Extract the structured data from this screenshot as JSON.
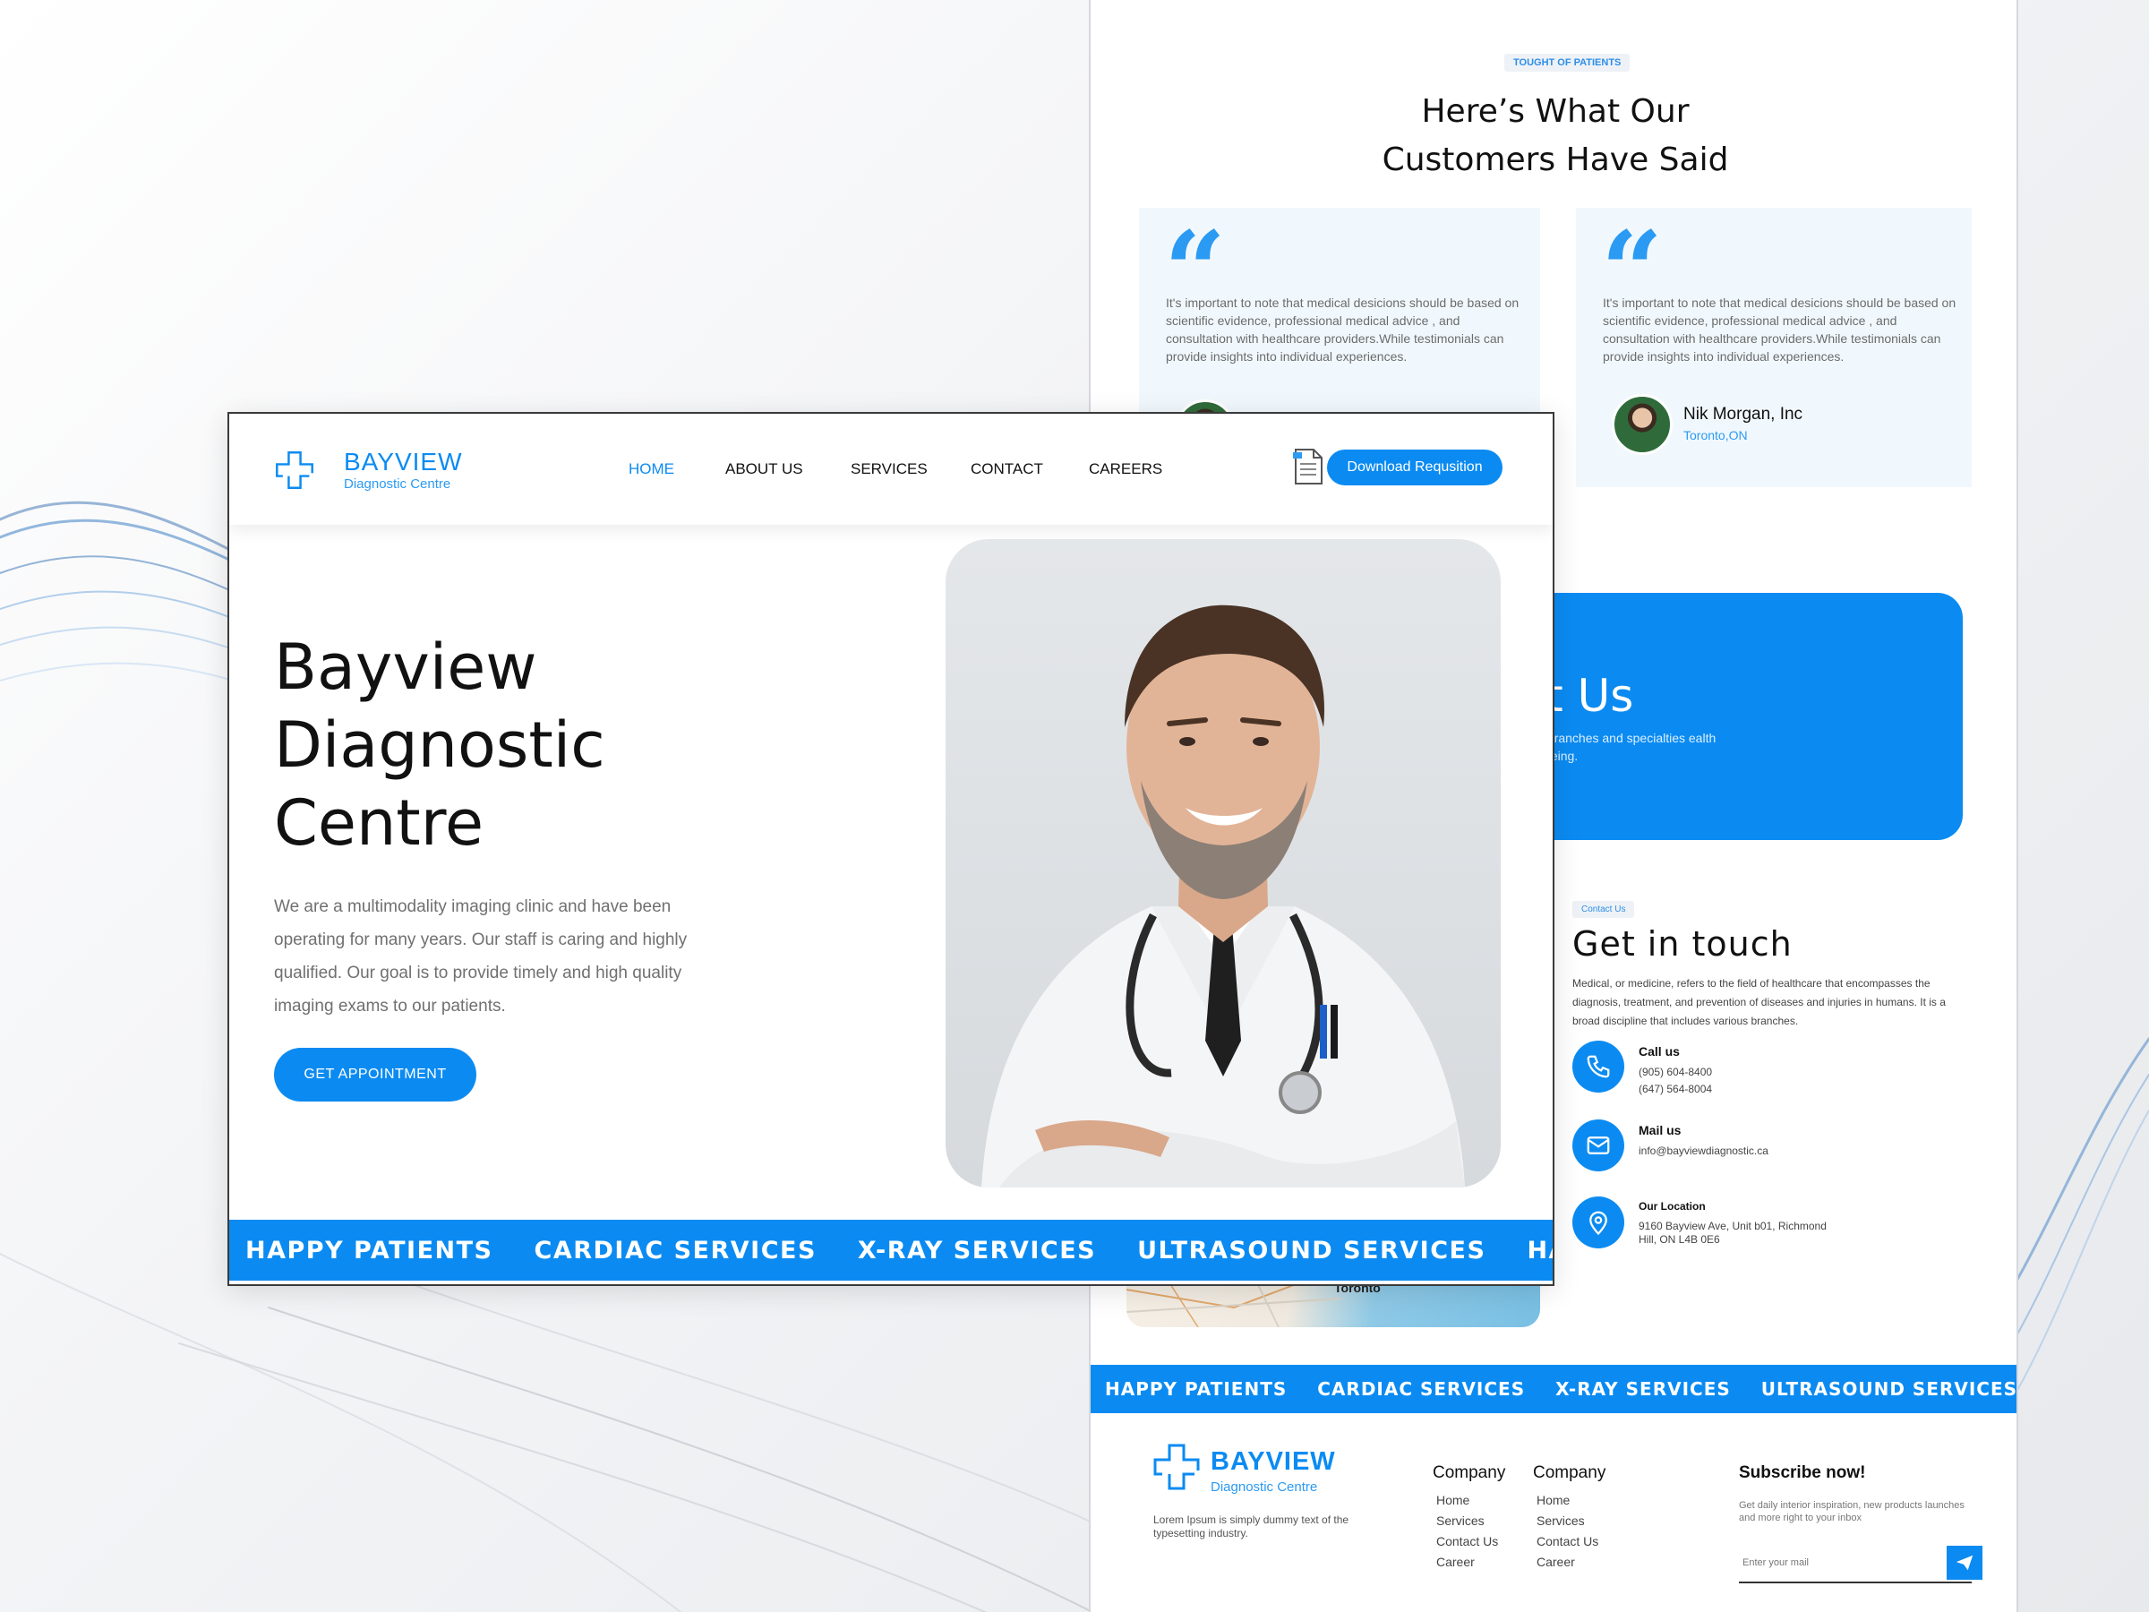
{
  "colors": {
    "brand_blue": "#0b8bf2",
    "light_blue": "#2b9af3",
    "card_bg": "#f1f8fd"
  },
  "front": {
    "logo": {
      "brand": "BAYVIEW",
      "subtitle": "Diagnostic Centre",
      "icon": "medical-cross-icon"
    },
    "nav": [
      {
        "label": "HOME",
        "active": true
      },
      {
        "label": "ABOUT US",
        "active": false
      },
      {
        "label": "SERVICES",
        "active": false
      },
      {
        "label": "CONTACT",
        "active": false
      },
      {
        "label": "CAREERS",
        "active": false
      }
    ],
    "download_button": "Download Requsition",
    "hero": {
      "title": "Bayview Diagnostic Centre",
      "description": "We are a multimodality imaging clinic and have been operating for many years. Our staff is caring and highly qualified. Our goal is to provide timely and high quality imaging exams to our patients.",
      "cta": "GET APPOINTMENT"
    },
    "ticker": [
      "HAPPY PATIENTS",
      "CARDIAC SERVICES",
      "X-RAY SERVICES",
      "ULTRASOUND SERVICES",
      "HA"
    ]
  },
  "back": {
    "testimonials": {
      "tag": "TOUGHT OF PATIENTS",
      "title_line1": "Here’s What Our",
      "title_line2": "Customers Have Said",
      "quote_glyph": "“",
      "cards": [
        {
          "text": "It's important to note that medical desicions should be based on scientific evidence, professional medical advice , and consultation with healthcare providers.While testimonials can provide insights into individual experiences.",
          "name": "",
          "location": ""
        },
        {
          "text": "It's important to note that medical desicions should be based on scientific evidence, professional medical advice , and consultation with healthcare providers.While testimonials can provide insights into individual experiences.",
          "name": "Nik Morgan, Inc",
          "location": "Toronto,ON"
        }
      ]
    },
    "contact_banner": {
      "title": "act Us",
      "subtitle": "s various branches and specialties ealth and well-being."
    },
    "get_in_touch": {
      "tag": "Contact Us",
      "title": "Get in touch",
      "description": "Medical, or medicine, refers to the field of healthcare that encompasses the diagnosis, treatment, and prevention of diseases and injuries in humans. It is a broad discipline that includes various branches.",
      "call": {
        "label": "Call us",
        "line1": "(905) 604-8400",
        "line2": "(647) 564-8004"
      },
      "mail": {
        "label": "Mail us",
        "line1": "info@bayviewdiagnostic.ca"
      },
      "location": {
        "label": "Our Location",
        "line1": "9160 Bayview Ave, Unit b01, Richmond",
        "line2": "Hill, ON L4B 0E6"
      },
      "map_label": "Toronto"
    },
    "ticker": [
      "HAPPY PATIENTS",
      "CARDIAC SERVICES",
      "X-RAY SERVICES",
      "ULTRASOUND SERVICES",
      "HA"
    ],
    "footer": {
      "brand": "BAYVIEW",
      "brand_sub": "Diagnostic Centre",
      "description": "Lorem Ipsum is simply dummy text of the typesetting industry.",
      "columns": [
        {
          "title": "Company",
          "links": [
            "Home",
            "Services",
            "Contact Us",
            "Career"
          ]
        },
        {
          "title": "Company",
          "links": [
            "Home",
            "Services",
            "Contact Us",
            "Career"
          ]
        }
      ],
      "subscribe": {
        "title": "Subscribe now!",
        "description": "Get daily interior inspiration, new products launches and more right to your inbox",
        "placeholder": "Enter your mail"
      }
    }
  }
}
